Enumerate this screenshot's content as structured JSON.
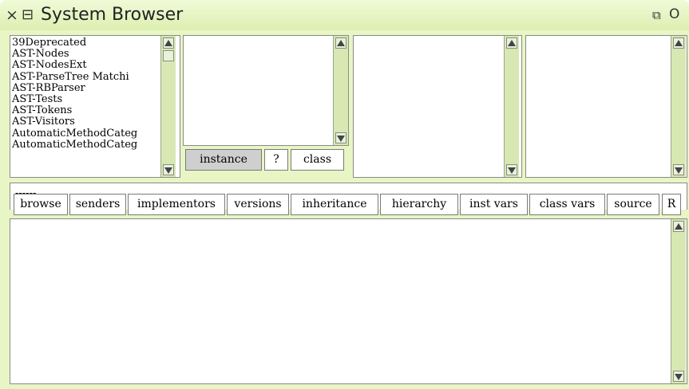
{
  "window": {
    "title": "System Browser",
    "close_glyph": "×",
    "menu_glyph": "⊟",
    "collapse_glyph": "⧉",
    "expand_glyph": "O"
  },
  "packages": {
    "items": [
      "39Deprecated",
      "AST-Nodes",
      "AST-NodesExt",
      "AST-ParseTree Matchi",
      "AST-RBParser",
      "AST-Tests",
      "AST-Tokens",
      "AST-Visitors",
      "AutomaticMethodCateg",
      "AutomaticMethodCateg"
    ]
  },
  "class_toggle": {
    "instance": "instance",
    "help": "?",
    "class": "class"
  },
  "annotation_text": "------",
  "button_bar": {
    "browse": "browse",
    "senders": "senders",
    "implementors": "implementors",
    "versions": "versions",
    "inheritance": "inheritance",
    "hierarchy": "hierarchy",
    "inst_vars": "inst vars",
    "class_vars": "class vars",
    "source": "source",
    "r": "R"
  },
  "colors": {
    "window_bg": "#e8f5c4",
    "scrollbar": "#d7e8b2",
    "selected_toggle": "#cfcfcf"
  }
}
